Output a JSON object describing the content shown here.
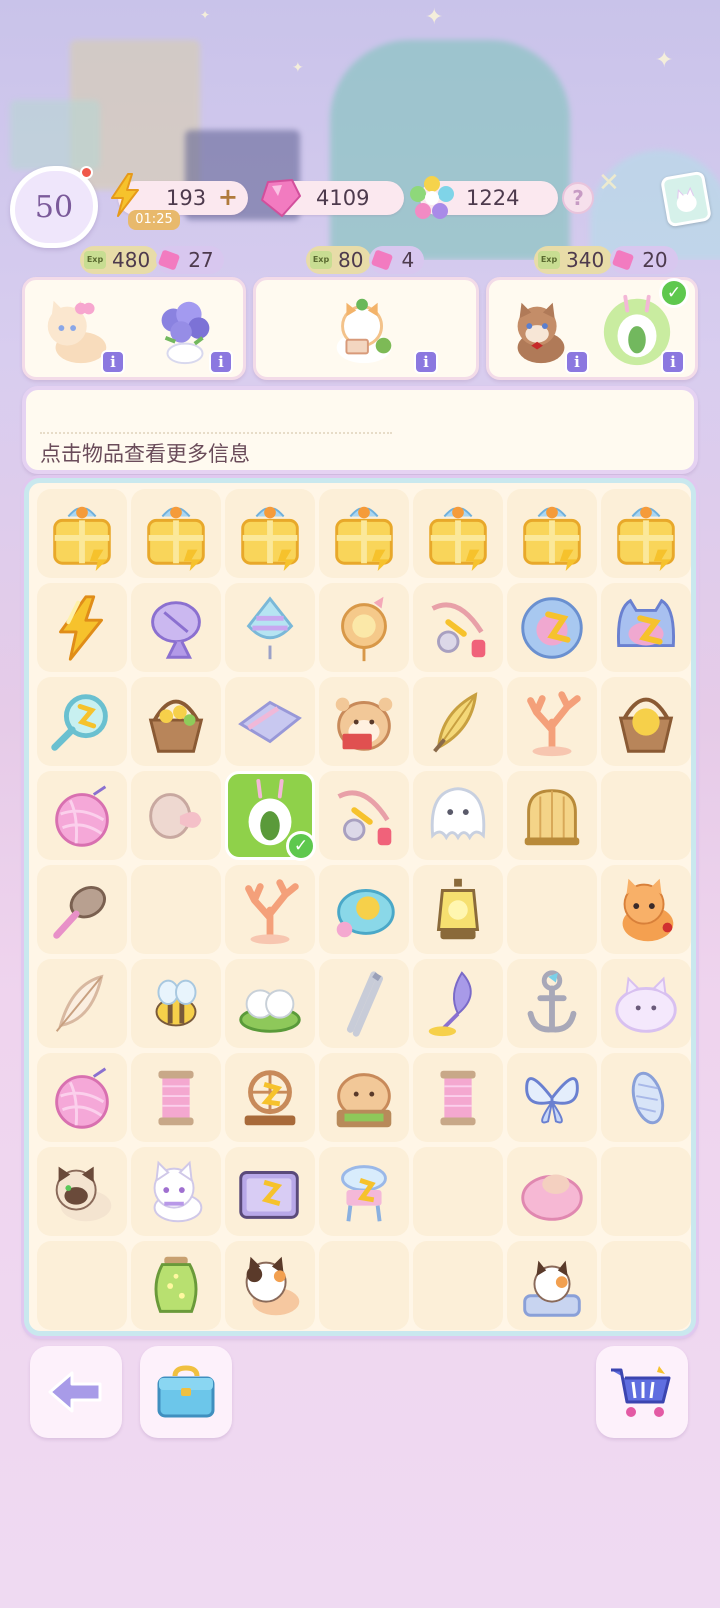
{
  "hud": {
    "level": "50",
    "energy": "193",
    "energy_timer": "01:25",
    "energy_plus": "+",
    "gems": "4109",
    "stars": "1224",
    "help": "?"
  },
  "orders": [
    {
      "exp": "480",
      "gems": "27",
      "items": [
        "cat-with-bow-icon",
        "flower-vase-icon"
      ]
    },
    {
      "exp": "80",
      "gems": "4",
      "items": [
        "cat-with-letter-icon"
      ]
    },
    {
      "exp": "340",
      "gems": "20",
      "items": [
        "brown-cat-icon",
        "bunny-leaf-icon"
      ],
      "completed_item": "bunny-leaf-icon"
    }
  ],
  "exp_chip_label": "Exp",
  "info_badge": "i",
  "info": {
    "text": "点击物品查看更多信息"
  },
  "board": {
    "rows": 9,
    "cols": 7,
    "selected": [
      3,
      2
    ],
    "cells": [
      [
        "gift-box-icon",
        "gift-box-icon",
        "gift-box-icon",
        "gift-box-icon",
        "gift-box-icon",
        "gift-box-icon",
        "gift-box-icon"
      ],
      [
        "energy-bolt-icon",
        "satellite-dish-icon",
        "spinning-top-icon",
        "brooch-icon",
        "fishing-rod-icon",
        "blue-cushion-icon",
        "cat-bed-icon"
      ],
      [
        "magnifier-icon",
        "flower-basket-icon",
        "towel-icon",
        "hamster-reading-icon",
        "feather-fan-icon",
        "coral-icon",
        "basket-icon"
      ],
      [
        "yarn-ball-icon",
        "ribbon-spool-icon",
        "bunny-leaf-icon",
        "fishing-rod-icon",
        "ghost-icon",
        "bird-cage-icon",
        ""
      ],
      [
        "brush-icon",
        "",
        "coral-icon",
        "bubble-bath-icon",
        "lantern-icon",
        "",
        "orange-cat-icon"
      ],
      [
        "feather-icon",
        "bee-icon",
        "rice-ball-icon",
        "tweezers-icon",
        "lavender-icon",
        "anchor-icon",
        "cloud-cat-icon"
      ],
      [
        "yarn-ball-icon",
        "thread-spool-icon",
        "spinning-wheel-icon",
        "hamster-sewing-icon",
        "thread-spool-icon",
        "butterfly-icon",
        "cocoon-icon"
      ],
      [
        "siamese-cat-icon",
        "white-cat-icon",
        "sewing-box-icon",
        "vanity-icon",
        "",
        "pink-blob-icon",
        ""
      ],
      [
        "",
        "firefly-jar-icon",
        "calico-cat-icon",
        "",
        "",
        "calico-cat-bed-icon",
        ""
      ]
    ]
  },
  "colors": {
    "accent": "#8b78e0",
    "energy": "#f6c22c",
    "gem": "#f27bc0",
    "selected_cell": "#8fd14a"
  },
  "buttons": [
    "back-arrow-icon",
    "toolbox-icon",
    "shop-cart-icon"
  ]
}
